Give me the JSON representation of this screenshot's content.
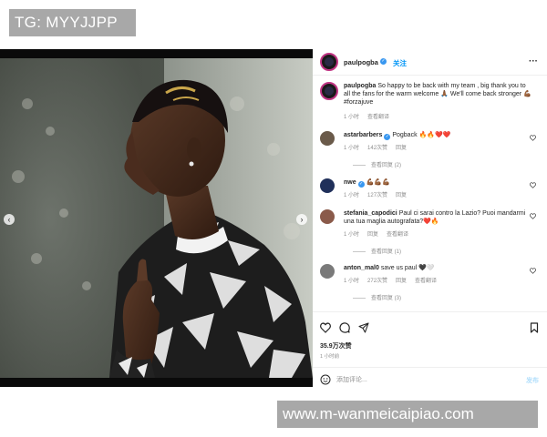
{
  "watermarks": {
    "top": "TG: MYYJJPP",
    "bottom": "www.m-wanmeicaipiao.com"
  },
  "header": {
    "username": "paulpogba",
    "follow_label": "关注",
    "more_label": "···",
    "verified_icon": "verified-badge-icon"
  },
  "caption": {
    "username": "paulpogba",
    "text": "So happy to be back with my team , big thank you to all the fans for the warm welcome 🙏🏾 We'll come back stronger 💪🏾 #forzajuve",
    "time": "1 小时",
    "translate": "查看翻译"
  },
  "comments": [
    {
      "username": "astarbarbers",
      "verified": true,
      "text": "Pogback 🔥🔥❤️❤️",
      "time": "1 小时",
      "likes": "142次赞",
      "reply": "回复",
      "view_replies": "查看回复 (2)"
    },
    {
      "username": "nwe",
      "verified": true,
      "text": "💪🏾💪🏾💪🏾",
      "time": "1 小时",
      "likes": "127次赞",
      "reply": "回复",
      "view_replies": ""
    },
    {
      "username": "stefania_capodici",
      "verified": false,
      "text": "Paul ci sarai contro la Lazio? Puoi mandarmi una tua maglia autografata?❤️🔥",
      "time": "1 小时",
      "likes": "回复",
      "reply": "查看翻译",
      "view_replies": "查看回复 (1)"
    },
    {
      "username": "anton_mal0",
      "verified": false,
      "text": "save us paul 🖤🤍",
      "time": "1 小时",
      "likes": "272次赞",
      "reply": "回复",
      "translate": "查看翻译",
      "view_replies": "查看回复 (3)"
    }
  ],
  "actions": {
    "like_icon": "heart-icon",
    "comment_icon": "comment-icon",
    "share_icon": "share-icon",
    "save_icon": "bookmark-icon",
    "likes_count": "35.9万次赞",
    "post_time": "1 小时前"
  },
  "add_comment": {
    "placeholder": "添加评论...",
    "post_label": "发布"
  },
  "media": {
    "prev_icon": "chevron-left-icon",
    "next_icon": "chevron-right-icon"
  }
}
